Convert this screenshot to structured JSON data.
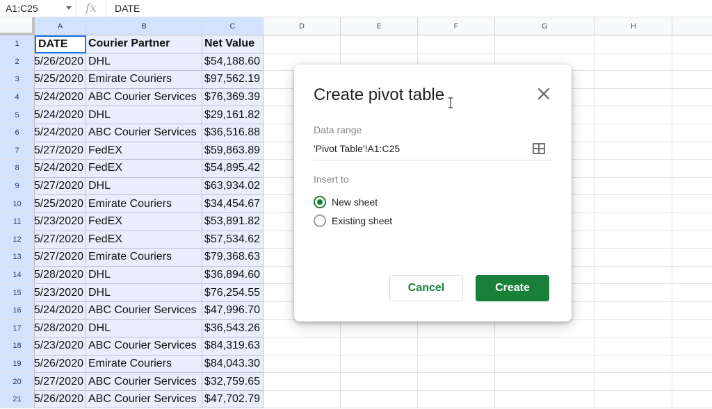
{
  "formula_bar": {
    "name_box": "A1:C25",
    "fx_label": "fx",
    "content": "DATE"
  },
  "columns": [
    "A",
    "B",
    "C",
    "D",
    "E",
    "F",
    "G",
    "H"
  ],
  "rows": [
    {
      "num": "1",
      "date": "DATE",
      "partner": "Courier Partner",
      "value": "Net Value"
    },
    {
      "num": "2",
      "date": "5/26/2020",
      "partner": "DHL",
      "value": "$54,188.60"
    },
    {
      "num": "3",
      "date": "5/25/2020",
      "partner": "Emirate Couriers",
      "value": "$97,562.19"
    },
    {
      "num": "4",
      "date": "5/24/2020",
      "partner": "ABC Courier Services",
      "value": "$76,369.39"
    },
    {
      "num": "5",
      "date": "5/24/2020",
      "partner": "DHL",
      "value": "$29,161.82"
    },
    {
      "num": "6",
      "date": "5/24/2020",
      "partner": "ABC Courier Services",
      "value": "$36,516.88"
    },
    {
      "num": "7",
      "date": "5/27/2020",
      "partner": "FedEX",
      "value": "$59,863.89"
    },
    {
      "num": "8",
      "date": "5/24/2020",
      "partner": "FedEX",
      "value": "$54,895.42"
    },
    {
      "num": "9",
      "date": "5/27/2020",
      "partner": "DHL",
      "value": "$63,934.02"
    },
    {
      "num": "10",
      "date": "5/25/2020",
      "partner": "Emirate Couriers",
      "value": "$34,454.67"
    },
    {
      "num": "11",
      "date": "5/23/2020",
      "partner": "FedEX",
      "value": "$53,891.82"
    },
    {
      "num": "12",
      "date": "5/27/2020",
      "partner": "FedEX",
      "value": "$57,534.62"
    },
    {
      "num": "13",
      "date": "5/27/2020",
      "partner": "Emirate Couriers",
      "value": "$79,368.63"
    },
    {
      "num": "14",
      "date": "5/28/2020",
      "partner": "DHL",
      "value": "$36,894.60"
    },
    {
      "num": "15",
      "date": "5/23/2020",
      "partner": "DHL",
      "value": "$76,254.55"
    },
    {
      "num": "16",
      "date": "5/24/2020",
      "partner": "ABC Courier Services",
      "value": "$47,996.70"
    },
    {
      "num": "17",
      "date": "5/28/2020",
      "partner": "DHL",
      "value": "$36,543.26"
    },
    {
      "num": "18",
      "date": "5/23/2020",
      "partner": "ABC Courier Services",
      "value": "$84,319.63"
    },
    {
      "num": "19",
      "date": "5/26/2020",
      "partner": "Emirate Couriers",
      "value": "$84,043.30"
    },
    {
      "num": "20",
      "date": "5/27/2020",
      "partner": "ABC Courier Services",
      "value": "$32,759.65"
    },
    {
      "num": "21",
      "date": "5/26/2020",
      "partner": "ABC Courier Services",
      "value": "$47,702.79"
    }
  ],
  "dialog": {
    "title": "Create pivot table",
    "data_range_label": "Data range",
    "data_range_value": "'Pivot Table'!A1:C25",
    "insert_to_label": "Insert to",
    "options": [
      {
        "label": "New sheet",
        "checked": true
      },
      {
        "label": "Existing sheet",
        "checked": false
      }
    ],
    "cancel_label": "Cancel",
    "create_label": "Create"
  },
  "colors": {
    "accent": "#188038",
    "selection": "#e8eefb",
    "header_selected": "#d3e3fd"
  }
}
